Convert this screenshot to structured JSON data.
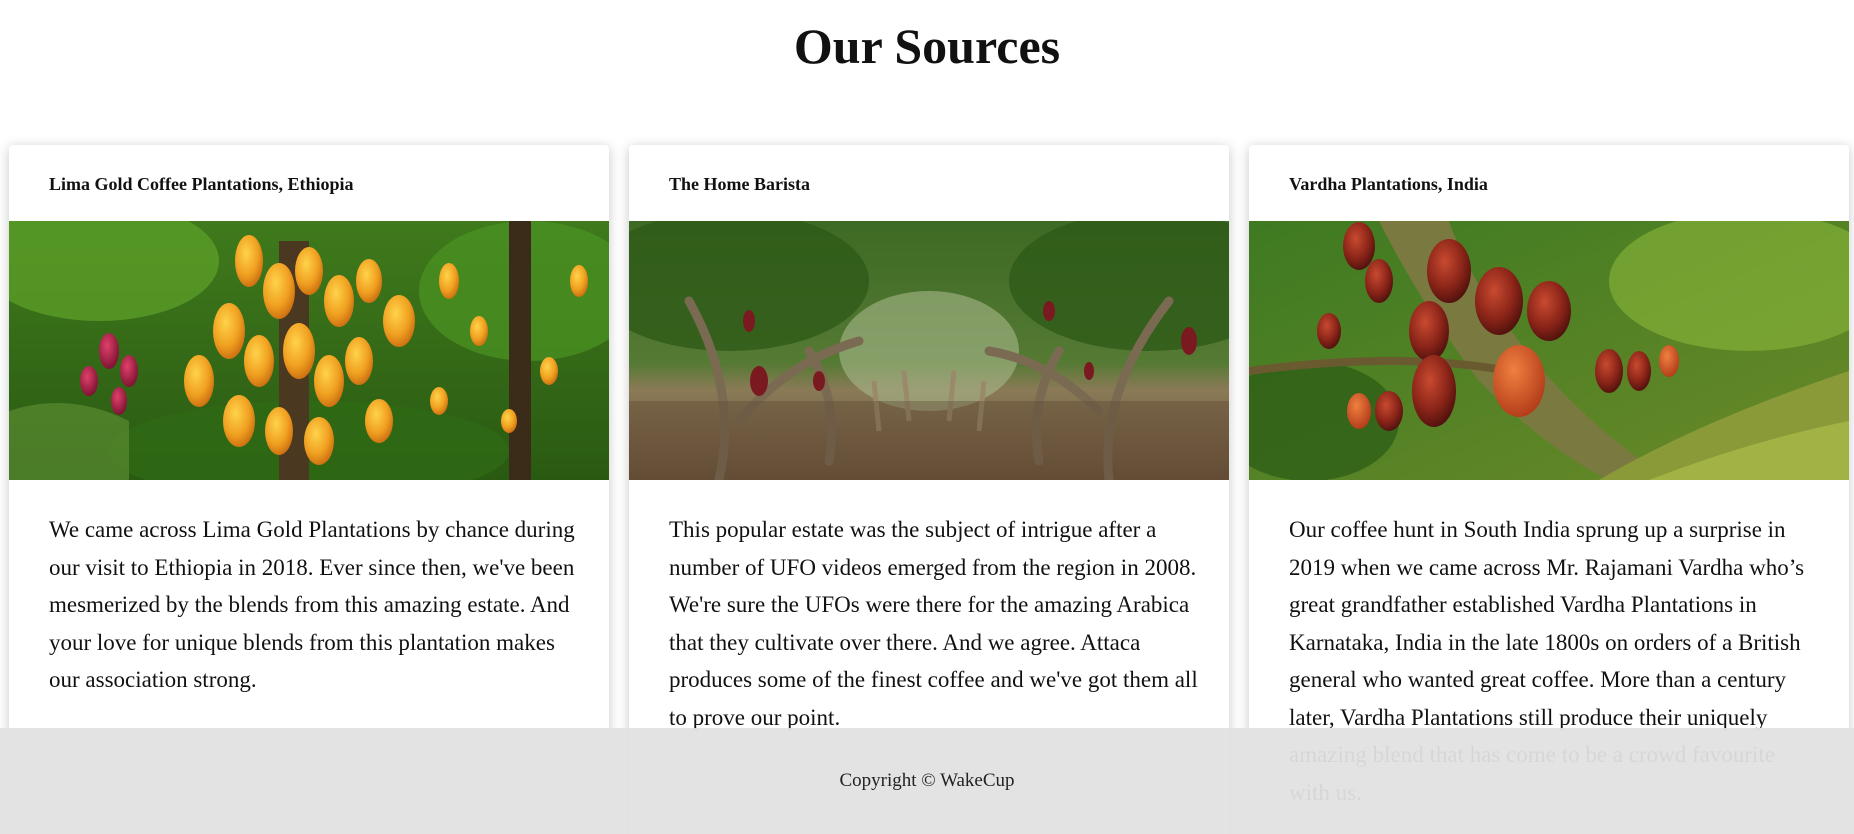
{
  "page": {
    "title": "Our Sources"
  },
  "sources": [
    {
      "title": "Lima Gold Coffee Plantations, Ethiopia",
      "image": "cacao-pods-orange-photo",
      "text": "We came across Lima Gold Plantations by chance during our visit to Ethiopia in 2018. Ever since then, we've been mesmerized by the blends from this amazing estate. And your love for unique blends from this plantation makes our association strong."
    },
    {
      "title": "The Home Barista",
      "image": "plantation-orchard-photo",
      "text": "This popular estate was the subject of intrigue after a number of UFO videos emerged from the region in 2008. We're sure the UFOs were there for the amazing Arabica that they cultivate over there. And we agree. Attaca produces some of the finest coffee and we've got them all to prove our point."
    },
    {
      "title": "Vardha Plantations, India",
      "image": "cacao-pods-red-photo",
      "text": "Our coffee hunt in South India sprung up a surprise in 2019 when we came across Mr. Rajamani Vardha who’s great grandfather established Vardha Plantations in Karnataka, India in the late 1800s on orders of a British general who wanted great coffee. More than a century later, Vardha Plantations still produce their uniquely amazing blend that has come to be a crowd favourite with us."
    }
  ],
  "footer": {
    "copyright": "Copyright © WakeCup"
  }
}
